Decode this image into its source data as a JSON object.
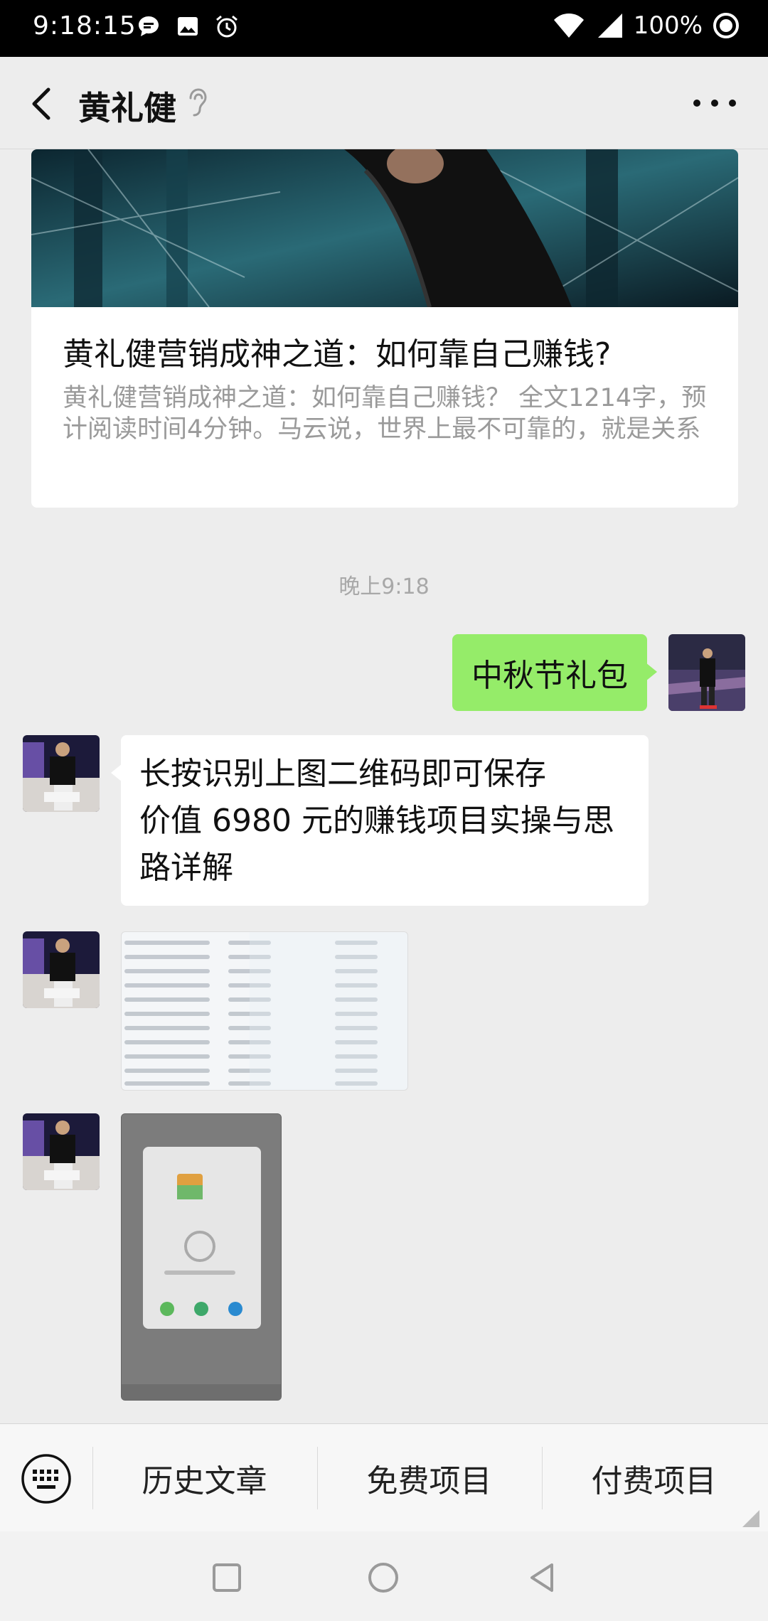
{
  "status_bar": {
    "time": "9:18:15",
    "battery": "100%"
  },
  "header": {
    "title": "黄礼健"
  },
  "article": {
    "title": "黄礼健营销成神之道：如何靠自己赚钱?",
    "description": "黄礼健营销成神之道：如何靠自己赚钱？ 全文1214字，预计阅读时间4分钟。马云说，世界上最不可靠的，就是关系"
  },
  "chat": {
    "timestamp": "晚上9:18",
    "outgoing_message": "中秋节礼包",
    "incoming_message_line1": "长按识别上图二维码即可保存",
    "incoming_message_line2": "价值 6980 元的赚钱项目实操与思",
    "incoming_message_line3": "路详解"
  },
  "menu": {
    "items": [
      {
        "label": "历史文章"
      },
      {
        "label": "免费项目"
      },
      {
        "label": "付费项目"
      }
    ]
  },
  "colors": {
    "bubble_out": "#95ec69",
    "background": "#ededed"
  },
  "icons": [
    "message-icon",
    "image-icon",
    "alarm-icon",
    "wifi-icon",
    "signal-icon",
    "battery-circle-icon",
    "back-arrow-icon",
    "ear-icon",
    "more-icon",
    "keyboard-icon",
    "square-icon",
    "circle-icon",
    "triangle-back-icon"
  ]
}
